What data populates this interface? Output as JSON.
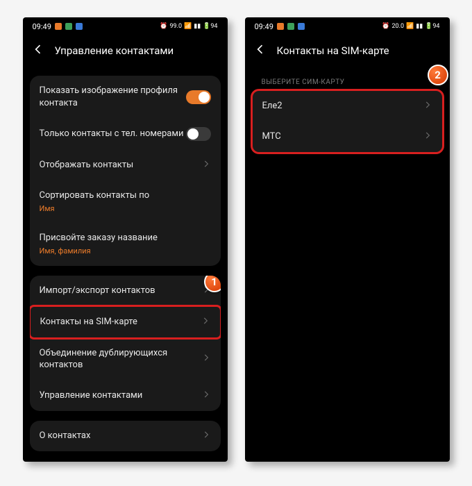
{
  "status": {
    "time": "09:49",
    "net": "99.0",
    "net2": "20.0",
    "batt": "94"
  },
  "left": {
    "title": "Управление контактами",
    "badge1": "1",
    "rows": {
      "show_image": "Показать изображение профиля контакта",
      "only_phone": "Только контакты с тел. номерами",
      "display": "Отображать контакты",
      "sort": "Сортировать контакты по",
      "sort_sub": "Имя",
      "order": "Присвойте заказу название",
      "order_sub": "Имя, фамилия",
      "import": "Импорт/экспорт контактов",
      "sim": "Контакты на SIM-карте",
      "merge": "Объединение дублирующихся контактов",
      "manage": "Управление контактами",
      "about": "О контактах"
    }
  },
  "right": {
    "title": "Контакты на SIM-карте",
    "section": "Выберите сим-карту",
    "badge2": "2",
    "sim1": "Еле2",
    "sim2": "МТС"
  }
}
